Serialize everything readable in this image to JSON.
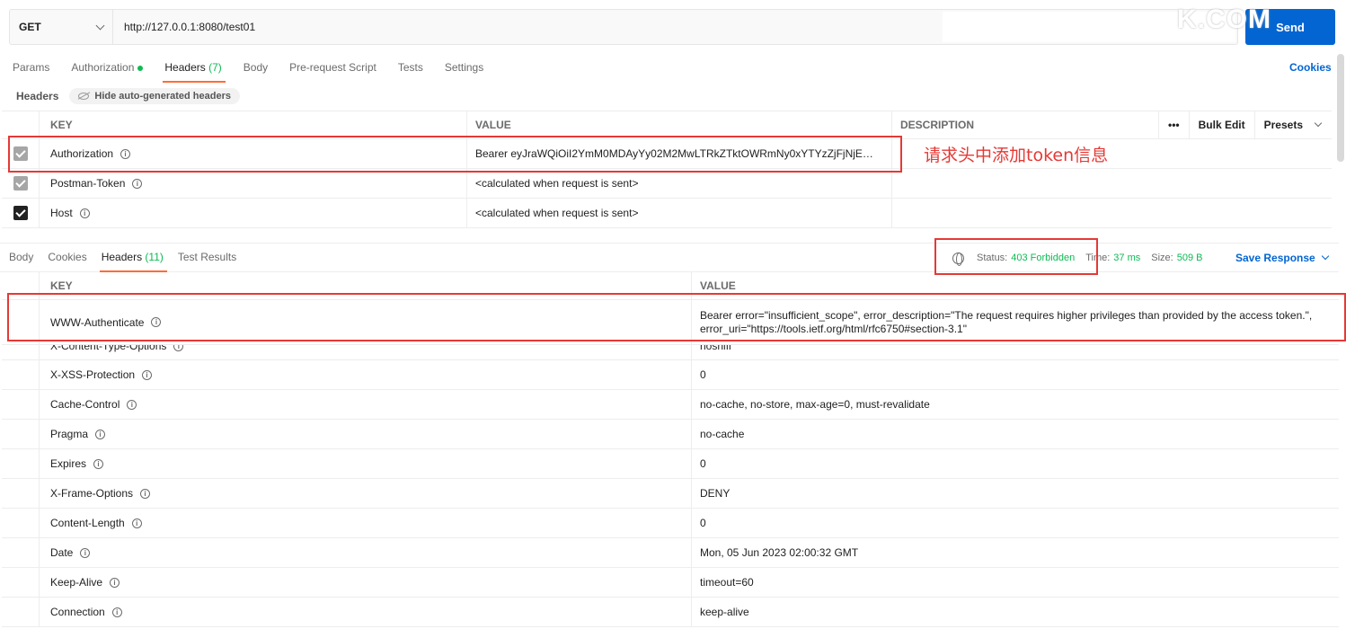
{
  "request": {
    "method": "GET",
    "url": "http://127.0.0.1:8080/test01",
    "send_label": "Send",
    "watermark": "K.COM"
  },
  "req_tabs": [
    {
      "label": "Params"
    },
    {
      "label": "Authorization"
    },
    {
      "label": "Headers",
      "count": "(7)"
    },
    {
      "label": "Body"
    },
    {
      "label": "Pre-request Script"
    },
    {
      "label": "Tests"
    },
    {
      "label": "Settings"
    }
  ],
  "cookies_label": "Cookies",
  "headers_section": {
    "title": "Headers",
    "hide_label": "Hide auto-generated headers"
  },
  "req_table": {
    "columns": {
      "key": "KEY",
      "value": "VALUE",
      "description": "DESCRIPTION"
    },
    "more": "•••",
    "bulk_edit": "Bulk Edit",
    "presets": "Presets",
    "rows": [
      {
        "key": "Authorization",
        "value": "Bearer eyJraWQiOiI2YmM0MDAyYy02M2MwLTRkZTktOWRmNy0xYTYzZjFjNjE…"
      },
      {
        "key": "Postman-Token",
        "value": "<calculated when request is sent>"
      },
      {
        "key": "Host",
        "value": "<calculated when request is sent>"
      }
    ]
  },
  "annotation": "请求头中添加token信息",
  "resp_tabs": [
    {
      "label": "Body"
    },
    {
      "label": "Cookies"
    },
    {
      "label": "Headers",
      "count": "(11)"
    },
    {
      "label": "Test Results"
    }
  ],
  "status": {
    "status_label": "Status:",
    "status_value": "403 Forbidden",
    "time_label": "Time:",
    "time_value": "37 ms",
    "size_label": "Size:",
    "size_value": "509 B",
    "save_label": "Save Response"
  },
  "resp_table": {
    "columns": {
      "key": "KEY",
      "value": "VALUE"
    },
    "rows": [
      {
        "key": "WWW-Authenticate",
        "value": "Bearer error=\"insufficient_scope\", error_description=\"The request requires higher privileges than provided by the access token.\", error_uri=\"https://tools.ietf.org/html/rfc6750#section-3.1\""
      },
      {
        "key": "X-Content-Type-Options",
        "value": "nosniff"
      },
      {
        "key": "X-XSS-Protection",
        "value": "0"
      },
      {
        "key": "Cache-Control",
        "value": "no-cache, no-store, max-age=0, must-revalidate"
      },
      {
        "key": "Pragma",
        "value": "no-cache"
      },
      {
        "key": "Expires",
        "value": "0"
      },
      {
        "key": "X-Frame-Options",
        "value": "DENY"
      },
      {
        "key": "Content-Length",
        "value": "0"
      },
      {
        "key": "Date",
        "value": "Mon, 05 Jun 2023 02:00:32 GMT"
      },
      {
        "key": "Keep-Alive",
        "value": "timeout=60"
      },
      {
        "key": "Connection",
        "value": "keep-alive"
      }
    ]
  },
  "colors": {
    "accent": "#ff6c37",
    "send": "#0265d2",
    "success": "#0cbb52",
    "annotation": "#e53935"
  }
}
